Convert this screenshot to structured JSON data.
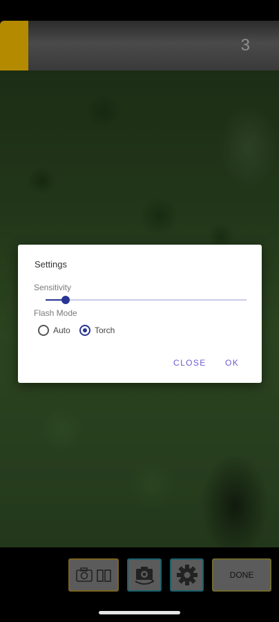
{
  "top_bar": {
    "count": "3",
    "accent_color": "#b38a00"
  },
  "dialog": {
    "title": "Settings",
    "sensitivity_label": "Sensitivity",
    "sensitivity_value": 0.1,
    "flash_mode_label": "Flash Mode",
    "flash_options": [
      {
        "label": "Auto",
        "checked": false
      },
      {
        "label": "Torch",
        "checked": true
      }
    ],
    "close_label": "CLOSE",
    "ok_label": "OK",
    "accent_color": "#283593"
  },
  "bottom_bar": {
    "mode_icons": [
      "camera-icon",
      "pages-icon"
    ],
    "flip_icon": "camera-switch-icon",
    "settings_icon": "gear-icon",
    "done_label": "DONE"
  }
}
